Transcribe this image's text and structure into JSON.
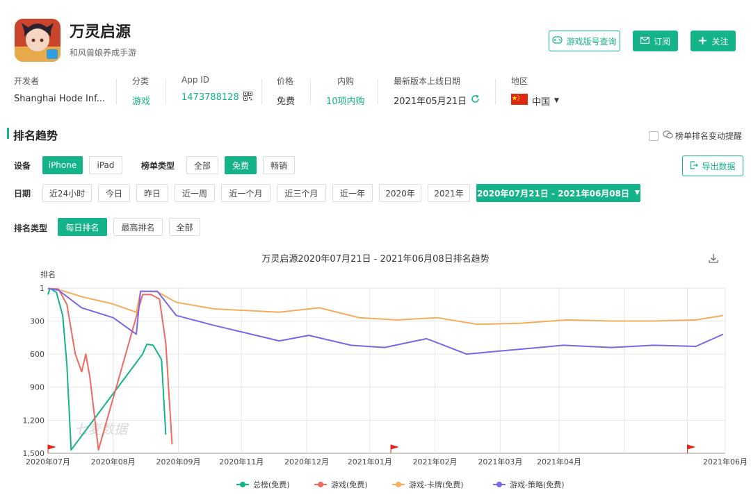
{
  "app": {
    "title": "万灵启源",
    "subtitle": "和风兽娘养成手游"
  },
  "actions": {
    "version_query": "游戏版号查询",
    "subscribe": "订阅",
    "follow": "关注"
  },
  "meta": [
    {
      "label": "开发者",
      "value": "Shanghai Hode Inf..."
    },
    {
      "label": "分类",
      "value": "游戏"
    },
    {
      "label": "App ID",
      "value": "1473788128"
    },
    {
      "label": "价格",
      "value": "免费"
    },
    {
      "label": "内购",
      "value": "10项内购"
    },
    {
      "label": "最新版本上线日期",
      "value": "2021年05月21日"
    },
    {
      "label": "地区",
      "value": "中国"
    }
  ],
  "section": {
    "title": "排名趋势",
    "alert_label": "榜单排名变动提醒",
    "export_label": "导出数据"
  },
  "filters": {
    "device_label": "设备",
    "devices": [
      "iPhone",
      "iPad"
    ],
    "list_type_label": "榜单类型",
    "list_types": [
      "全部",
      "免费",
      "畅销"
    ],
    "date_label": "日期",
    "dates": [
      "近24小时",
      "今日",
      "昨日",
      "近一周",
      "近一个月",
      "近三个月",
      "近一年",
      "2020年",
      "2021年"
    ],
    "date_range": "2020年07月21日 - 2021年06月08日",
    "rank_type_label": "排名类型",
    "rank_types": [
      "每日排名",
      "最高排名",
      "全部"
    ]
  },
  "watermark": "七麦数据",
  "chart_data": {
    "type": "line",
    "title": "万灵启源2020年07月21日 - 2021年06月08日排名趋势",
    "ylabel": "排名",
    "y_inverted": true,
    "ylim": [
      1,
      1500
    ],
    "y_ticks": [
      "1",
      "300",
      "600",
      "900",
      "1,200",
      "1,500"
    ],
    "x_ticks": [
      "2020年07月",
      "2020年08月",
      "2020年09月",
      "2020年11月",
      "2020年12月",
      "2021年01月",
      "2021年02月",
      "2021年03月",
      "2021年04月",
      "2021年06月"
    ],
    "grid": true,
    "legend_position": "bottom",
    "markers_at": [
      "2020-07-21",
      "2020-12-31",
      "2021-05-21"
    ],
    "series": [
      {
        "name": "总榜(免费)",
        "color": "#14b38a",
        "points": [
          [
            "2020-07-21",
            60
          ],
          [
            "2020-07-22",
            5
          ],
          [
            "2020-07-25",
            40
          ],
          [
            "2020-07-28",
            250
          ],
          [
            "2020-07-30",
            700
          ],
          [
            "2020-08-01",
            1470
          ],
          [
            "2020-09-04",
            600
          ],
          [
            "2020-09-06",
            510
          ],
          [
            "2020-09-09",
            520
          ],
          [
            "2020-09-13",
            650
          ],
          [
            "2020-09-15",
            1330
          ]
        ]
      },
      {
        "name": "游戏(免费)",
        "color": "#ee6a5e",
        "points": [
          [
            "2020-07-21",
            5
          ],
          [
            "2020-07-26",
            10
          ],
          [
            "2020-07-30",
            150
          ],
          [
            "2020-08-03",
            600
          ],
          [
            "2020-08-06",
            760
          ],
          [
            "2020-08-08",
            600
          ],
          [
            "2020-08-10",
            820
          ],
          [
            "2020-08-14",
            1470
          ],
          [
            "2020-09-04",
            60
          ],
          [
            "2020-09-08",
            60
          ],
          [
            "2020-09-12",
            100
          ],
          [
            "2020-09-15",
            500
          ],
          [
            "2020-09-18",
            1420
          ]
        ]
      },
      {
        "name": "游戏-卡牌(免费)",
        "color": "#f5ad5b",
        "points": [
          [
            "2020-07-21",
            5
          ],
          [
            "2020-07-28",
            25
          ],
          [
            "2020-08-06",
            80
          ],
          [
            "2020-08-20",
            140
          ],
          [
            "2020-09-01",
            220
          ],
          [
            "2020-09-03",
            30
          ],
          [
            "2020-09-11",
            35
          ],
          [
            "2020-09-20",
            130
          ],
          [
            "2020-10-08",
            190
          ],
          [
            "2020-11-08",
            220
          ],
          [
            "2020-11-27",
            180
          ],
          [
            "2020-12-16",
            270
          ],
          [
            "2021-01-03",
            290
          ],
          [
            "2021-01-22",
            270
          ],
          [
            "2021-02-10",
            330
          ],
          [
            "2021-03-03",
            320
          ],
          [
            "2021-03-25",
            290
          ],
          [
            "2021-04-15",
            300
          ],
          [
            "2021-05-05",
            300
          ],
          [
            "2021-05-25",
            290
          ],
          [
            "2021-06-07",
            250
          ]
        ]
      },
      {
        "name": "游戏-策略(免费)",
        "color": "#7b65e8",
        "points": [
          [
            "2020-07-21",
            5
          ],
          [
            "2020-07-26",
            20
          ],
          [
            "2020-08-06",
            180
          ],
          [
            "2020-08-21",
            270
          ],
          [
            "2020-09-01",
            420
          ],
          [
            "2020-09-03",
            30
          ],
          [
            "2020-09-11",
            30
          ],
          [
            "2020-09-20",
            250
          ],
          [
            "2020-10-08",
            340
          ],
          [
            "2020-11-08",
            480
          ],
          [
            "2020-11-22",
            430
          ],
          [
            "2020-12-12",
            520
          ],
          [
            "2020-12-28",
            540
          ],
          [
            "2021-01-17",
            460
          ],
          [
            "2021-02-05",
            600
          ],
          [
            "2021-02-28",
            560
          ],
          [
            "2021-03-23",
            520
          ],
          [
            "2021-04-15",
            540
          ],
          [
            "2021-05-05",
            520
          ],
          [
            "2021-05-25",
            530
          ],
          [
            "2021-06-07",
            420
          ]
        ]
      }
    ]
  }
}
